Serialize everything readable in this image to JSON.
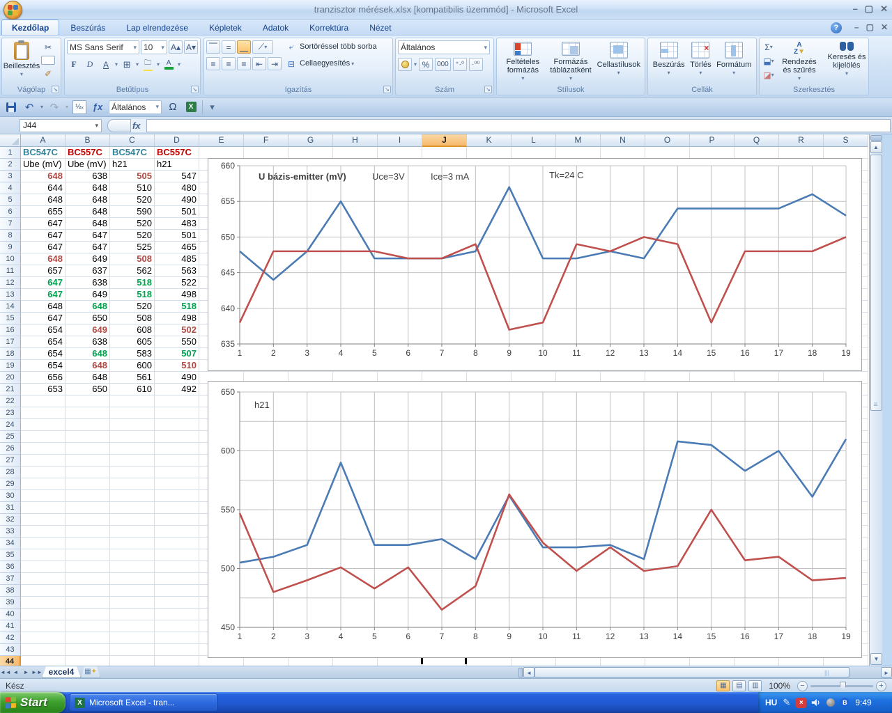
{
  "window": {
    "title": "tranzisztor mérések.xlsx  [kompatibilis üzemmód] - Microsoft Excel",
    "minimize": "–",
    "restore": "▢",
    "close": "✕",
    "help": "?"
  },
  "ribbon": {
    "tabs": [
      {
        "label": "Kezdőlap",
        "active": true
      },
      {
        "label": "Beszúrás",
        "active": false
      },
      {
        "label": "Lap elrendezése",
        "active": false
      },
      {
        "label": "Képletek",
        "active": false
      },
      {
        "label": "Adatok",
        "active": false
      },
      {
        "label": "Korrektúra",
        "active": false
      },
      {
        "label": "Nézet",
        "active": false
      }
    ],
    "clipboard": {
      "group": "Vágólap",
      "paste": "Beillesztés",
      "cut_icon": "✂"
    },
    "font": {
      "group": "Betűtípus",
      "name": "MS Sans Serif",
      "size": "10",
      "bold": "F",
      "italic": "D",
      "underline": "A",
      "grow": "A▴",
      "shrink": "A▾"
    },
    "alignment": {
      "group": "Igazítás",
      "wrap": "Sortöréssel több sorba",
      "merge": "Cellaegyesítés"
    },
    "number": {
      "group": "Szám",
      "format": "Általános",
      "percent": "%",
      "thousands": "000",
      "inc_dec": "⁺·⁰",
      "dec_dec": "·⁰⁰"
    },
    "styles": {
      "group": "Stílusok",
      "items": [
        "Feltételes formázás",
        "Formázás táblázatként",
        "Cellastílusok"
      ]
    },
    "cells": {
      "group": "Cellák",
      "items": [
        "Beszúrás",
        "Törlés",
        "Formátum"
      ]
    },
    "editing": {
      "group": "Szerkesztés",
      "sigma": "Σ",
      "items": [
        "Rendezés és szűrés",
        "Keresés és kijelölés"
      ]
    }
  },
  "qat": {
    "format_combo": "Általános",
    "omega": "Ω",
    "undo": "↶",
    "redo": "↷",
    "fraction": "½ₓ",
    "fx": "ƒx"
  },
  "formula_bar": {
    "name_box": "J44",
    "fx": "fx",
    "formula": ""
  },
  "grid": {
    "columns": [
      "A",
      "B",
      "C",
      "D",
      "E",
      "F",
      "G",
      "H",
      "I",
      "J",
      "K",
      "L",
      "M",
      "N",
      "O",
      "P",
      "Q",
      "R",
      "S"
    ],
    "selected_column": "J",
    "selected_row": 44,
    "rows_visible": 44,
    "style_colors": {
      "red": "#AE4A44",
      "green": "#00A24E"
    },
    "table": {
      "header_row": {
        "values": [
          "BC547C",
          "BC557C",
          "BC547C",
          "BC557C"
        ],
        "colors": [
          "#31859C",
          "#C00000",
          "#31859C",
          "#C00000"
        ]
      },
      "unit_row": [
        "Ube (mV)",
        "Ube (mV)",
        "h21",
        "h21"
      ],
      "data": [
        [
          648,
          638,
          505,
          547
        ],
        [
          644,
          648,
          510,
          480
        ],
        [
          648,
          648,
          520,
          490
        ],
        [
          655,
          648,
          590,
          501
        ],
        [
          647,
          648,
          520,
          483
        ],
        [
          647,
          647,
          520,
          501
        ],
        [
          647,
          647,
          525,
          465
        ],
        [
          648,
          649,
          508,
          485
        ],
        [
          657,
          637,
          562,
          563
        ],
        [
          647,
          638,
          518,
          522
        ],
        [
          647,
          649,
          518,
          498
        ],
        [
          648,
          648,
          520,
          518
        ],
        [
          647,
          650,
          508,
          498
        ],
        [
          654,
          649,
          608,
          502
        ],
        [
          654,
          638,
          605,
          550
        ],
        [
          654,
          648,
          583,
          507
        ],
        [
          654,
          648,
          600,
          510
        ],
        [
          656,
          648,
          561,
          490
        ],
        [
          653,
          650,
          610,
          492
        ]
      ],
      "cell_styles": [
        [
          "red",
          null,
          "red",
          null
        ],
        [
          null,
          null,
          null,
          null
        ],
        [
          null,
          null,
          null,
          null
        ],
        [
          null,
          null,
          null,
          null
        ],
        [
          null,
          null,
          null,
          null
        ],
        [
          null,
          null,
          null,
          null
        ],
        [
          null,
          null,
          null,
          null
        ],
        [
          "red",
          null,
          "red",
          null
        ],
        [
          null,
          null,
          null,
          null
        ],
        [
          "green",
          null,
          "green",
          null
        ],
        [
          "green",
          null,
          "green",
          null
        ],
        [
          null,
          "green",
          null,
          "green"
        ],
        [
          null,
          null,
          null,
          null
        ],
        [
          null,
          "red",
          null,
          "red"
        ],
        [
          null,
          null,
          null,
          null
        ],
        [
          null,
          "green",
          null,
          "green"
        ],
        [
          null,
          "red",
          null,
          "red"
        ],
        [
          null,
          null,
          null,
          null
        ],
        [
          null,
          null,
          null,
          null
        ]
      ]
    }
  },
  "chart_data": [
    {
      "type": "line",
      "title": "U bázis-emitter (mV)",
      "x": [
        1,
        2,
        3,
        4,
        5,
        6,
        7,
        8,
        9,
        10,
        11,
        12,
        13,
        14,
        15,
        16,
        17,
        18,
        19
      ],
      "series": [
        {
          "name": "BC547C Ube (mV)",
          "color": "#4A7BB5",
          "values": [
            648,
            644,
            648,
            655,
            647,
            647,
            647,
            648,
            657,
            647,
            647,
            648,
            647,
            654,
            654,
            654,
            654,
            656,
            653
          ]
        },
        {
          "name": "BC557C Ube (mV)",
          "color": "#C0504D",
          "values": [
            638,
            648,
            648,
            648,
            648,
            647,
            647,
            649,
            637,
            638,
            649,
            648,
            650,
            649,
            638,
            648,
            648,
            648,
            650
          ]
        }
      ],
      "ylim": [
        635,
        660
      ],
      "grid_step": 5,
      "ytick_step": 5,
      "grid": true,
      "legend": "none",
      "annotations": [
        {
          "text": "U bázis-emitter  (mV)",
          "x": 72,
          "y": 30,
          "bold": true
        },
        {
          "text": "Uce=3V",
          "x": 235,
          "y": 30,
          "bold": false
        },
        {
          "text": "Ice=3 mA",
          "x": 319,
          "y": 30,
          "bold": false
        },
        {
          "text": "Tk=24 C",
          "x": 489,
          "y": 28,
          "bold": false
        }
      ]
    },
    {
      "type": "line",
      "title": "h21",
      "x": [
        1,
        2,
        3,
        4,
        5,
        6,
        7,
        8,
        9,
        10,
        11,
        12,
        13,
        14,
        15,
        16,
        17,
        18,
        19
      ],
      "series": [
        {
          "name": "BC547C h21",
          "color": "#4A7BB5",
          "values": [
            505,
            510,
            520,
            590,
            520,
            520,
            525,
            508,
            562,
            518,
            518,
            520,
            508,
            608,
            605,
            583,
            600,
            561,
            610
          ]
        },
        {
          "name": "BC557C h21",
          "color": "#C0504D",
          "values": [
            547,
            480,
            490,
            501,
            483,
            501,
            465,
            485,
            563,
            522,
            498,
            518,
            498,
            502,
            550,
            507,
            510,
            490,
            492
          ]
        }
      ],
      "ylim": [
        450,
        650
      ],
      "grid_step": 25,
      "ytick_step": 50,
      "grid": true,
      "legend": "none",
      "annotations": [
        {
          "text": "h21",
          "x": 66,
          "y": 38,
          "bold": false
        }
      ]
    }
  ],
  "sheet_tabs": {
    "active": "excel4"
  },
  "status_bar": {
    "ready": "Kész",
    "zoom": "100%"
  },
  "taskbar": {
    "start": "Start",
    "task": "Microsoft Excel - tran...",
    "lang": "HU",
    "time": "9:49"
  }
}
